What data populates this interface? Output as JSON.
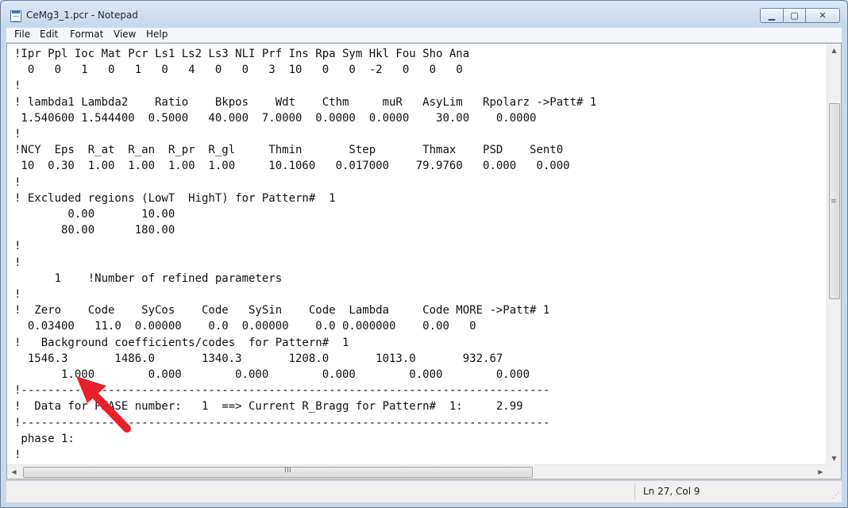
{
  "window": {
    "title": "CeMg3_1.pcr - Notepad",
    "minimize_glyph": "▁",
    "maximize_glyph": "▢",
    "close_glyph": "✕"
  },
  "menu": {
    "file": "File",
    "edit": "Edit",
    "format": "Format",
    "view": "View",
    "help": "Help"
  },
  "editor": {
    "lines": [
      "!Ipr Ppl Ioc Mat Pcr Ls1 Ls2 Ls3 NLI Prf Ins Rpa Sym Hkl Fou Sho Ana",
      "  0   0   1   0   1   0   4   0   0   3  10   0   0  -2   0   0   0",
      "!",
      "! lambda1 Lambda2    Ratio    Bkpos    Wdt    Cthm     muR   AsyLim   Rpolarz ->Patt# 1",
      " 1.540600 1.544400  0.5000   40.000  7.0000  0.0000  0.0000    30.00    0.0000",
      "!",
      "!NCY  Eps  R_at  R_an  R_pr  R_gl     Thmin       Step       Thmax    PSD    Sent0",
      " 10  0.30  1.00  1.00  1.00  1.00     10.1060   0.017000    79.9760   0.000   0.000",
      "!",
      "! Excluded regions (LowT  HighT) for Pattern#  1",
      "        0.00       10.00",
      "       80.00      180.00",
      "!",
      "!",
      "      1    !Number of refined parameters",
      "!",
      "!  Zero    Code    SyCos    Code   SySin    Code  Lambda     Code MORE ->Patt# 1",
      "  0.03400   11.0  0.00000    0.0  0.00000    0.0 0.000000    0.00   0",
      "!   Background coefficients/codes  for Pattern#  1",
      "  1546.3       1486.0       1340.3       1208.0       1013.0       932.67",
      "       1.000        0.000        0.000        0.000        0.000        0.000",
      "!-------------------------------------------------------------------------------",
      "!  Data for PHASE number:   1  ==> Current R_Bragg for Pattern#  1:     2.99",
      "!-------------------------------------------------------------------------------",
      " phase 1:",
      "!"
    ]
  },
  "scrollbars": {
    "up_glyph": "▲",
    "down_glyph": "▼",
    "left_glyph": "◀",
    "right_glyph": "▶",
    "v_grip": "≡",
    "h_grip": "III"
  },
  "status": {
    "position": "Ln 27, Col 9",
    "grip_glyph": "⋰"
  },
  "annotation": {
    "arrow_color": "#e8202a"
  }
}
